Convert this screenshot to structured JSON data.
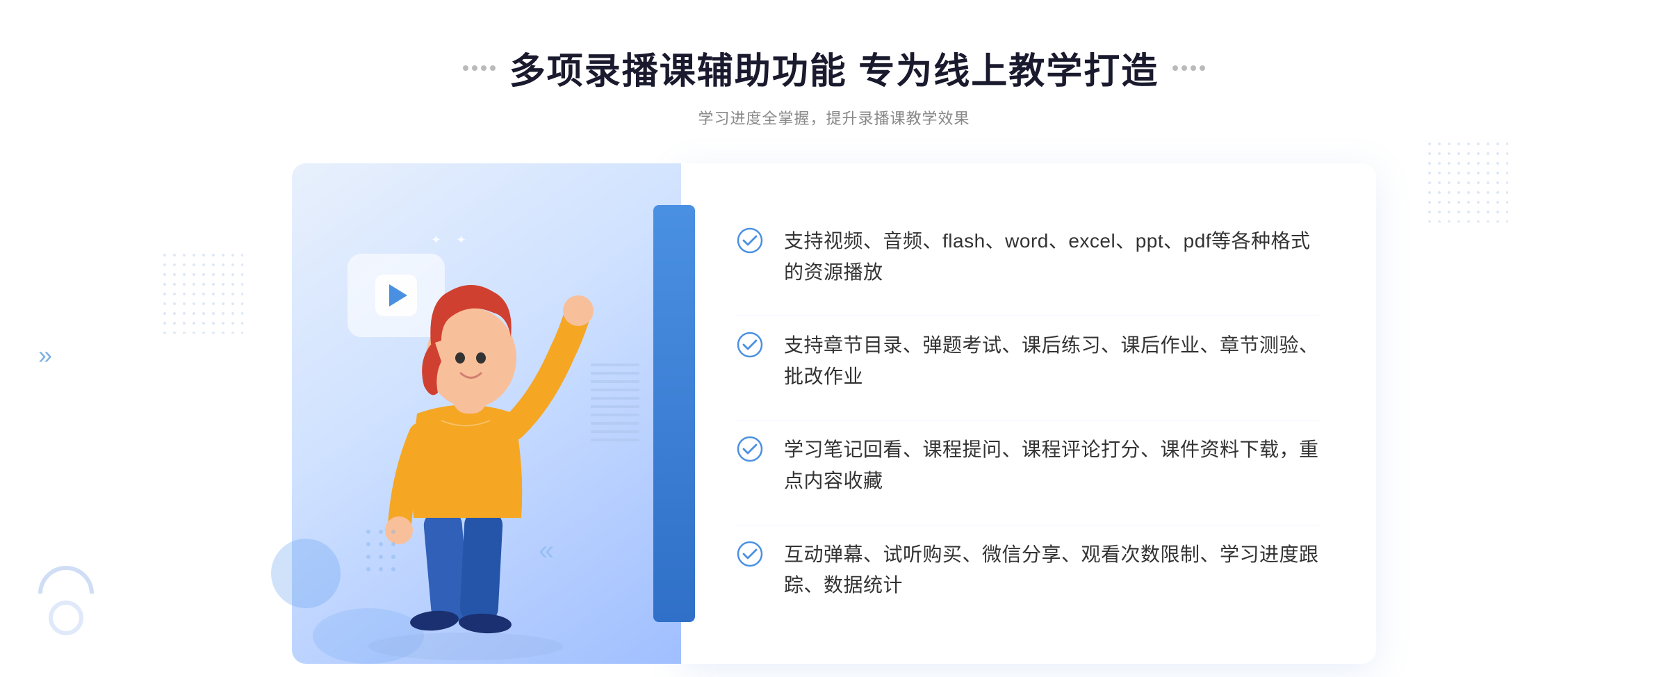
{
  "page": {
    "background_color": "#ffffff"
  },
  "header": {
    "title": "多项录播课辅助功能 专为线上教学打造",
    "subtitle": "学习进度全掌握，提升录播课教学效果",
    "title_dots_left": "decorative",
    "title_dots_right": "decorative"
  },
  "features": [
    {
      "id": 1,
      "text": "支持视频、音频、flash、word、excel、ppt、pdf等各种格式的资源播放"
    },
    {
      "id": 2,
      "text": "支持章节目录、弹题考试、课后练习、课后作业、章节测验、批改作业"
    },
    {
      "id": 3,
      "text": "学习笔记回看、课程提问、课程评论打分、课件资料下载，重点内容收藏"
    },
    {
      "id": 4,
      "text": "互动弹幕、试听购买、微信分享、观看次数限制、学习进度跟踪、数据统计"
    }
  ],
  "decoration": {
    "arrow_left": "»",
    "play_button": "▶"
  },
  "colors": {
    "primary_blue": "#4a90e2",
    "dark_blue": "#3070c8",
    "light_blue": "#d0e2ff",
    "text_dark": "#1a1a2e",
    "text_gray": "#888888",
    "text_body": "#333333",
    "check_color": "#4a90e2"
  }
}
